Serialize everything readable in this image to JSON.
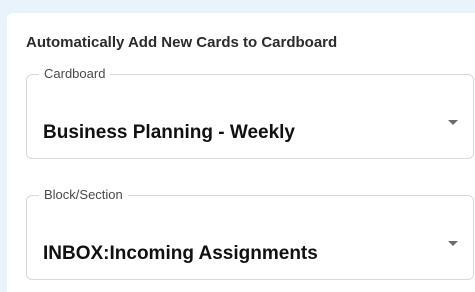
{
  "settings": {
    "heading": "Automatically Add New Cards to Cardboard",
    "cardboard": {
      "label": "Cardboard",
      "value": "Business Planning - Weekly",
      "icon": "chevron-down-icon"
    },
    "block_section": {
      "label": "Block/Section",
      "value": "INBOX:Incoming Assignments",
      "icon": "chevron-down-icon"
    }
  }
}
